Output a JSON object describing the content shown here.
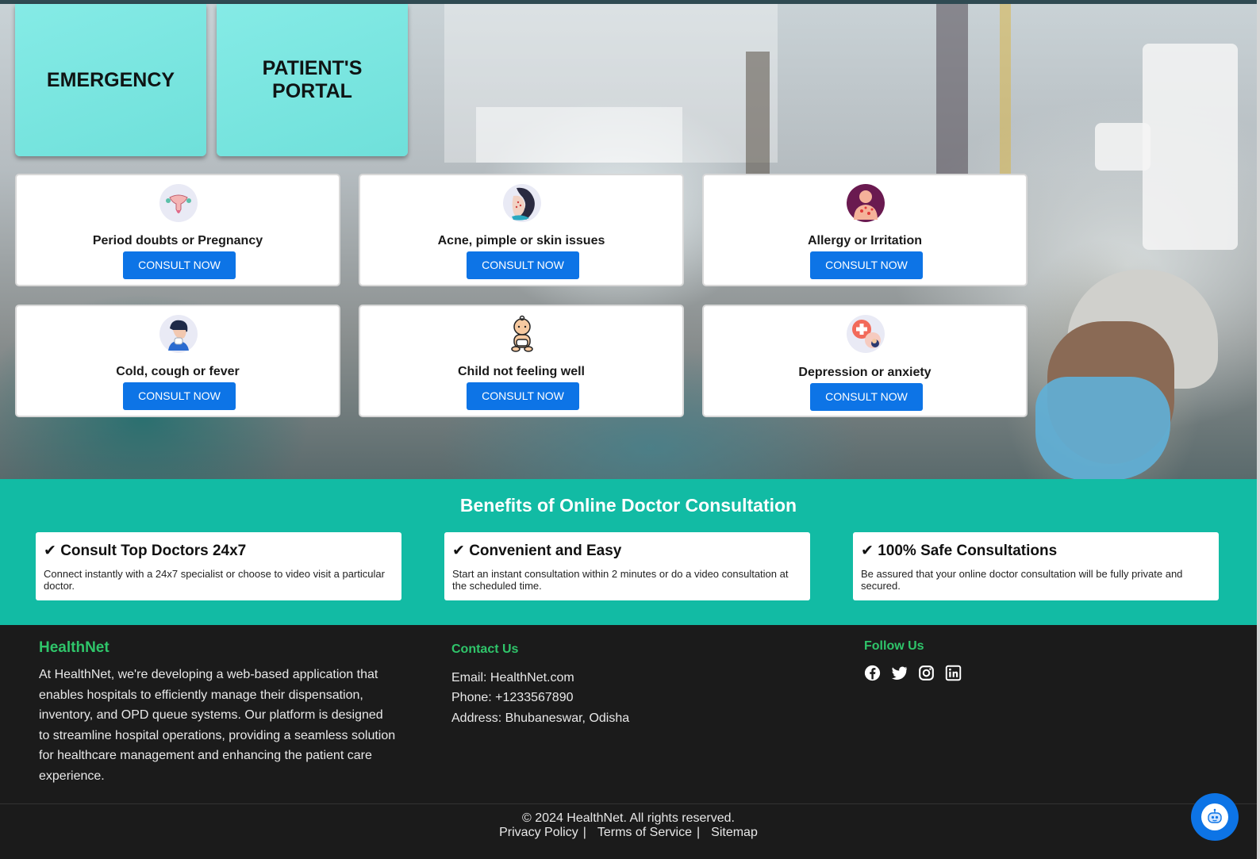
{
  "tiles": {
    "emergency": "EMERGENCY",
    "portal_line1": "PATIENT'S",
    "portal_line2": "PORTAL"
  },
  "consult_cards": [
    {
      "title": "Period doubts or Pregnancy",
      "button": "CONSULT NOW",
      "icon": "uterus-icon"
    },
    {
      "title": "Acne, pimple or skin issues",
      "button": "CONSULT NOW",
      "icon": "skin-icon"
    },
    {
      "title": "Allergy or Irritation",
      "button": "CONSULT NOW",
      "icon": "allergy-icon"
    },
    {
      "title": "Cold, cough or fever",
      "button": "CONSULT NOW",
      "icon": "cough-icon"
    },
    {
      "title": "Child not feeling well",
      "button": "CONSULT NOW",
      "icon": "baby-icon"
    },
    {
      "title": "Depression or anxiety",
      "button": "CONSULT NOW",
      "icon": "mental-health-icon"
    }
  ],
  "benefits": {
    "heading": "Benefits of Online Doctor Consultation",
    "items": [
      {
        "title": "✔ Consult Top Doctors 24x7",
        "desc": "Connect instantly with a 24x7 specialist or choose to video visit a particular doctor."
      },
      {
        "title": "✔ Convenient and Easy",
        "desc": "Start an instant consultation within 2 minutes or do a video consultation at the scheduled time."
      },
      {
        "title": "✔ 100% Safe Consultations",
        "desc": "Be assured that your online doctor consultation will be fully private and secured."
      }
    ]
  },
  "footer": {
    "brand": "HealthNet",
    "about": "At HealthNet, we're developing a web-based application that enables hospitals to efficiently manage their dispensation, inventory, and OPD queue systems. Our platform is designed to streamline hospital operations, providing a seamless solution for healthcare management and enhancing the patient care experience.",
    "contact_heading": "Contact Us",
    "email": "Email: HealthNet.com",
    "phone": "Phone: +1233567890",
    "address": "Address: Bhubaneswar, Odisha",
    "follow_heading": "Follow Us",
    "social_icons": [
      "facebook-icon",
      "twitter-icon",
      "instagram-icon",
      "linkedin-icon"
    ],
    "copyright": "© 2024 HealthNet. All rights reserved.",
    "privacy": "Privacy Policy",
    "terms": "Terms of Service",
    "sitemap": "Sitemap",
    "separator": "|"
  },
  "colors": {
    "accent_blue": "#0d74e6",
    "teal": "#12bba4",
    "green_heading": "#2fc56a",
    "tile": "#76e4de"
  }
}
